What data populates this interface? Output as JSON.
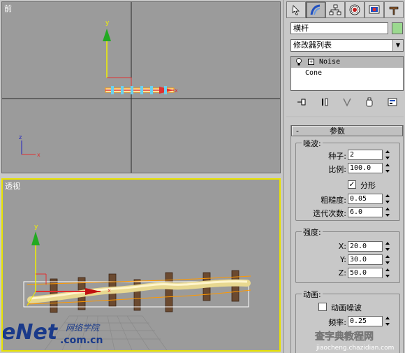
{
  "viewports": {
    "front": {
      "label": "前"
    },
    "perspective": {
      "label": "透视"
    }
  },
  "command_panel": {
    "tabs": [
      {
        "name": "create-tab",
        "icon": "create-icon"
      },
      {
        "name": "modify-tab",
        "icon": "modify-icon"
      },
      {
        "name": "hierarchy-tab",
        "icon": "hierarchy-icon"
      },
      {
        "name": "motion-tab",
        "icon": "motion-icon"
      },
      {
        "name": "display-tab",
        "icon": "display-icon"
      },
      {
        "name": "utilities-tab",
        "icon": "utilities-icon"
      }
    ],
    "object_name": "横杆",
    "object_color": "#9bd98f",
    "modifier_list": "修改器列表",
    "stack": {
      "noise": "Noise",
      "cone": "Cone"
    }
  },
  "parameters": {
    "rollout_minus": "-",
    "rollout_title": "参数",
    "noise_group": {
      "title": "噪波:",
      "seed_label": "种子:",
      "seed_value": "2",
      "scale_label": "比例:",
      "scale_value": "100.0",
      "fractal_label": "分形",
      "fractal_checked": "✓",
      "roughness_label": "粗糙度:",
      "roughness_value": "0.05",
      "iterations_label": "迭代次数:",
      "iterations_value": "6.0"
    },
    "strength_group": {
      "title": "强度:",
      "x_label": "X:",
      "x_value": "20.0",
      "y_label": "Y:",
      "y_value": "30.0",
      "z_label": "Z:",
      "z_value": "50.0"
    },
    "animation_group": {
      "title": "动画:",
      "animate_label": "动画噪波",
      "freq_label": "频率:",
      "freq_value": "0.25"
    }
  },
  "watermarks": {
    "enet": "eNet",
    "enet_cn": "网络学院",
    "enet_domain": ".com.cn",
    "jiaocheng": "查字典教程网",
    "jiaocheng_url": "jiaocheng.chazidian.com"
  },
  "colors": {
    "viewport_bg": "#9b9b9b",
    "active_viewport_border": "#e8e200",
    "panel_bg": "#c8c8c8",
    "axis_x": "#e03030",
    "axis_y": "#22aa22",
    "axis_z": "#2020c0"
  }
}
